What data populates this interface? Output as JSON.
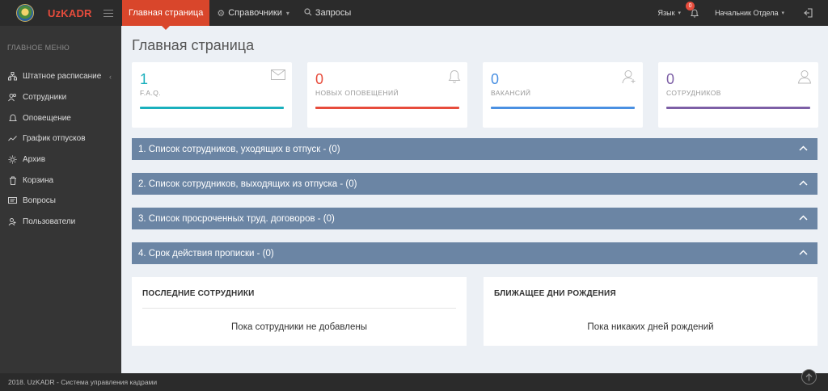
{
  "app": {
    "name": "UzKADR"
  },
  "topnav": {
    "home_label": "Главная страница",
    "directories_label": "Справочники",
    "requests_label": "Запросы",
    "language_label": "Язык",
    "notifications_count": "0",
    "user_label": "Начальник Отдела"
  },
  "sidebar": {
    "header": "ГЛАВНОЕ МЕНЮ",
    "items": [
      {
        "label": "Штатное расписание",
        "icon": "org-structure-icon"
      },
      {
        "label": "Сотрудники",
        "icon": "users-icon"
      },
      {
        "label": "Оповещение",
        "icon": "bell-icon"
      },
      {
        "label": "График отпусков",
        "icon": "trend-icon"
      },
      {
        "label": "Архив",
        "icon": "archive-icon"
      },
      {
        "label": "Корзина",
        "icon": "trash-icon"
      },
      {
        "label": "Вопросы",
        "icon": "chat-icon"
      },
      {
        "label": "Пользователи",
        "icon": "user-group-icon"
      }
    ]
  },
  "main": {
    "title": "Главная страница",
    "cards": [
      {
        "value": "1",
        "label": "F.A.Q.",
        "color": "#1ab0bd",
        "icon": "envelope-icon"
      },
      {
        "value": "0",
        "label": "НОВЫХ ОПОВЕЩЕНИЙ",
        "color": "#e74c3c",
        "icon": "bell-icon"
      },
      {
        "value": "0",
        "label": "ВАКАНСИЙ",
        "color": "#4a90e2",
        "icon": "user-add-icon"
      },
      {
        "value": "0",
        "label": "СОТРУДНИКОВ",
        "color": "#7d5fa6",
        "icon": "user-icon"
      }
    ],
    "accordions": [
      "1. Список сотрудников, уходящих в отпуск - (0)",
      "2. Список сотрудников, выходящих из отпуска - (0)",
      "3. Список просроченных труд. договоров - (0)",
      "4. Срок действия прописки - (0)"
    ],
    "recent_employees": {
      "title": "ПОСЛЕДНИЕ СОТРУДНИКИ",
      "empty_text": "Пока сотрудники не добавлены"
    },
    "birthdays": {
      "title": "БЛИЖАЩЕЕ ДНИ РОЖДЕНИЯ",
      "empty_text": "Пока никаких дней рождений"
    }
  },
  "footer": {
    "text": "2018. UzKADR - Система управления кадрами"
  },
  "colors": {
    "accent": "#d9462b",
    "accordion": "#6b85a4",
    "sidebar": "#353535",
    "topbar": "#2b2b2b"
  }
}
